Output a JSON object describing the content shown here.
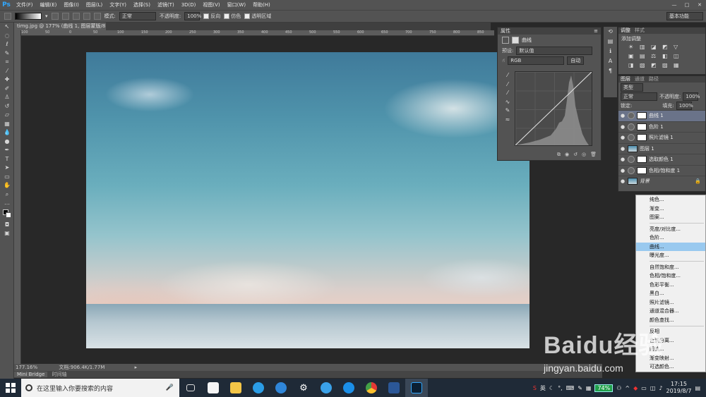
{
  "menubar": {
    "logo": "Ps",
    "items": [
      "文件(F)",
      "编辑(E)",
      "图像(I)",
      "图层(L)",
      "文字(Y)",
      "选择(S)",
      "滤镜(T)",
      "3D(D)",
      "视图(V)",
      "窗口(W)",
      "帮助(H)"
    ],
    "window_controls": [
      "—",
      "□",
      "✕"
    ]
  },
  "options": {
    "mode_label": "模式:",
    "mode_value": "正常",
    "opacity_label": "不透明度:",
    "opacity_value": "100%",
    "reverse_label": "反向",
    "dither_label": "仿色",
    "transparency_label": "透明区域",
    "workspace_value": "基本功能"
  },
  "document": {
    "tab_title": "timg.jpg @ 177% (曲线 1, 图层蒙版/8) *",
    "ruler_ticks": [
      "100",
      "50",
      "0",
      "50",
      "100",
      "150",
      "200",
      "250",
      "300",
      "350",
      "400",
      "450",
      "500",
      "550",
      "600",
      "650",
      "700",
      "750",
      "800",
      "850"
    ],
    "zoom": "177.16%",
    "doc_info": "文档:906.4K/1.77M"
  },
  "bottom_tabs": [
    "Mini Bridge",
    "时间轴"
  ],
  "properties": {
    "tab": "属性",
    "panel_title": "曲线",
    "preset_label": "预设:",
    "preset_value": "默认值",
    "channel_value": "RGB",
    "auto_label": "自动"
  },
  "adjustments": {
    "tabs": [
      "调整",
      "样式"
    ],
    "title": "添加调整"
  },
  "layers": {
    "tabs": [
      "图层",
      "通道",
      "路径"
    ],
    "filter_value": "类型",
    "blend_value": "正常",
    "opacity_label": "不透明度:",
    "opacity_value": "100%",
    "lock_label": "锁定:",
    "fill_label": "填充:",
    "fill_value": "100%",
    "items": [
      {
        "name": "曲线 1",
        "type": "adjustment",
        "selected": true
      },
      {
        "name": "色阶 1",
        "type": "adjustment",
        "selected": false
      },
      {
        "name": "照片滤镜 1",
        "type": "adjustment",
        "selected": false
      },
      {
        "name": "图层 1",
        "type": "image",
        "selected": false
      },
      {
        "name": "选取颜色 1",
        "type": "adjustment",
        "selected": false
      },
      {
        "name": "色相/饱和度 1",
        "type": "adjustment",
        "selected": false
      },
      {
        "name": "背景",
        "type": "background",
        "selected": false
      }
    ]
  },
  "context_menu": {
    "groups": [
      [
        "纯色...",
        "渐变...",
        "图案..."
      ],
      [
        "亮度/对比度...",
        "色阶...",
        "曲线...",
        "曝光度..."
      ],
      [
        "自然饱和度...",
        "色相/饱和度...",
        "色彩平衡...",
        "黑白...",
        "照片滤镜...",
        "通道混合器...",
        "颜色查找..."
      ],
      [
        "反相",
        "色调分离...",
        "阈值...",
        "渐变映射...",
        "可选颜色..."
      ]
    ],
    "highlighted": "曲线..."
  },
  "taskbar": {
    "search_placeholder": "在这里输入你要搜索的内容",
    "battery": "74%",
    "ime": "英",
    "time": "17:15",
    "date": "2019/8/7"
  },
  "watermark": {
    "text": "Baidu经验",
    "url": "jingyan.baidu.com"
  }
}
